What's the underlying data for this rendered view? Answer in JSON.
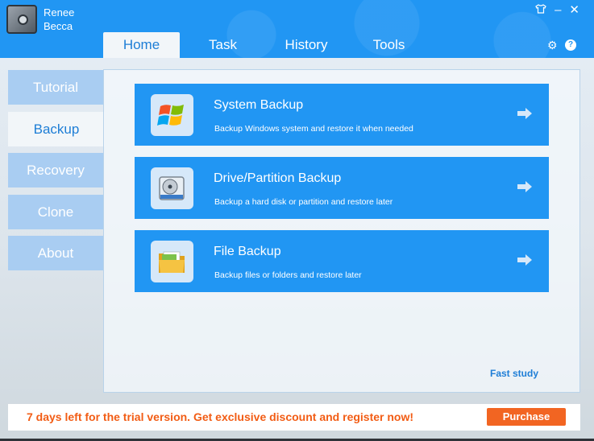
{
  "app": {
    "brand_line1": "Renee",
    "brand_line2": "Becca"
  },
  "window_controls": {
    "shirt_icon": "shirt-icon",
    "minimize": "–",
    "close": "✕"
  },
  "tabs": [
    {
      "label": "Home",
      "active": true
    },
    {
      "label": "Task",
      "active": false
    },
    {
      "label": "History",
      "active": false
    },
    {
      "label": "Tools",
      "active": false
    }
  ],
  "sidebar": {
    "items": [
      {
        "label": "Tutorial",
        "active": false
      },
      {
        "label": "Backup",
        "active": true
      },
      {
        "label": "Recovery",
        "active": false
      },
      {
        "label": "Clone",
        "active": false
      },
      {
        "label": "About",
        "active": false
      }
    ]
  },
  "cards": [
    {
      "title": "System Backup",
      "desc": "Backup Windows system and restore it when needed",
      "icon": "windows-logo-icon"
    },
    {
      "title": "Drive/Partition Backup",
      "desc": "Backup a hard disk or partition and restore later",
      "icon": "hard-disk-icon"
    },
    {
      "title": "File Backup",
      "desc": "Backup files or folders and restore later",
      "icon": "folder-icon"
    }
  ],
  "fast_study": "Fast study",
  "footer": {
    "trial_message": "7 days left for the trial version. Get exclusive discount and register now!",
    "purchase_label": "Purchase"
  },
  "colors": {
    "header_blue": "#2196f3",
    "card_blue": "#2196f3",
    "sidebar_inactive": "#a9cdf2",
    "accent_text": "#1e7ed6",
    "trial_orange": "#f25c14",
    "purchase_orange": "#f26522"
  }
}
